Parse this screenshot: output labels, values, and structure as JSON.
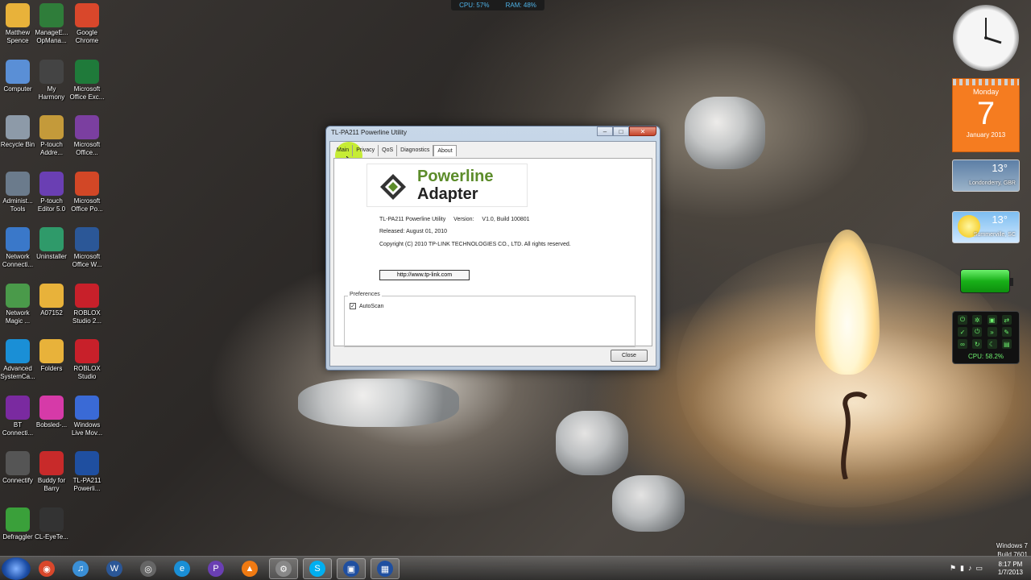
{
  "top_meter": {
    "cpu": "CPU: 57%",
    "ram": "RAM: 48%"
  },
  "desktop_icons": [
    {
      "label": "Matthew\nSpence",
      "icon": "folder-icon",
      "color": "#e8b23a"
    },
    {
      "label": "ManageE...\nOpMana...",
      "icon": "manage-engine-icon",
      "color": "#2f7d3a"
    },
    {
      "label": "Google\nChrome",
      "icon": "chrome-icon",
      "color": "#d9472b"
    },
    {
      "label": "Computer",
      "icon": "computer-icon",
      "color": "#5a8fd6"
    },
    {
      "label": "My\nHarmony",
      "icon": "harmony-icon",
      "color": "#444444"
    },
    {
      "label": "Microsoft\nOffice Exc...",
      "icon": "excel-icon",
      "color": "#1f7a3a"
    },
    {
      "label": "Recycle Bin",
      "icon": "recycle-bin-icon",
      "color": "#8d9aa8"
    },
    {
      "label": "P-touch\nAddre...",
      "icon": "ptouch-address-icon",
      "color": "#c49a3a"
    },
    {
      "label": "Microsoft\nOffice...",
      "icon": "onenote-icon",
      "color": "#7b3fa0"
    },
    {
      "label": "Administ...\nTools",
      "icon": "admin-tools-icon",
      "color": "#6b7b8c"
    },
    {
      "label": "P-touch\nEditor 5.0",
      "icon": "ptouch-editor-icon",
      "color": "#6a3fb3"
    },
    {
      "label": "Microsoft\nOffice Po...",
      "icon": "powerpoint-icon",
      "color": "#d24726"
    },
    {
      "label": "Network\nConnecti...",
      "icon": "network-connections-icon",
      "color": "#3a78c9"
    },
    {
      "label": "Uninstaller",
      "icon": "uninstaller-icon",
      "color": "#2f9a6a"
    },
    {
      "label": "Microsoft\nOffice W...",
      "icon": "word-icon",
      "color": "#2b5797"
    },
    {
      "label": "Network\nMagic ...",
      "icon": "network-magic-icon",
      "color": "#4a9a4a"
    },
    {
      "label": "A07152",
      "icon": "folder-icon",
      "color": "#e8b23a"
    },
    {
      "label": "ROBLOX\nStudio 2...",
      "icon": "roblox-icon",
      "color": "#c8202a"
    },
    {
      "label": "Advanced\nSystemCa...",
      "icon": "advanced-systemcare-icon",
      "color": "#1a8fd6"
    },
    {
      "label": "Folders",
      "icon": "folder-icon",
      "color": "#e8b23a"
    },
    {
      "label": "ROBLOX\nStudio",
      "icon": "roblox-icon",
      "color": "#c8202a"
    },
    {
      "label": "BT\nConnecti...",
      "icon": "bluetooth-icon",
      "color": "#7a2aa0"
    },
    {
      "label": "Bobsled-...",
      "icon": "bobsled-icon",
      "color": "#d63aa8"
    },
    {
      "label": "Windows\nLive Mov...",
      "icon": "movie-maker-icon",
      "color": "#3a6ad6"
    },
    {
      "label": "Connectify",
      "icon": "connectify-icon",
      "color": "#555555"
    },
    {
      "label": "Buddy for\nBarry",
      "icon": "buddy-icon",
      "color": "#c82a2a"
    },
    {
      "label": "TL-PA211\nPowerli...",
      "icon": "tplink-app-icon",
      "color": "#1f4fa0"
    },
    {
      "label": "Defraggler",
      "icon": "defraggler-icon",
      "color": "#3aa03a"
    },
    {
      "label": "CL-EyeTe...",
      "icon": "webcam-icon",
      "color": "#333333"
    }
  ],
  "gadgets": {
    "calendar": {
      "weekday": "Monday",
      "day": "7",
      "month_year": "January 2013"
    },
    "weather": [
      {
        "temp": "13°",
        "location": "Londonderry, GBR"
      },
      {
        "temp": "13°",
        "location": "Summerville, SC"
      }
    ],
    "controls": {
      "cpu": "CPU: 58.2%"
    }
  },
  "window": {
    "title": "TL-PA211 Powerline Utility",
    "tabs": [
      "Main",
      "Privacy",
      "QoS",
      "Diagnostics",
      "About"
    ],
    "active_tab": "About",
    "logo_line1": "Powerline",
    "logo_line2": "Adapter",
    "product": "TL-PA211 Powerline Utility",
    "version_label": "Version:",
    "version_value": "V1.0, Build 100801",
    "released": "Released: August 01, 2010",
    "copyright": "Copyright (C) 2010 TP-LINK TECHNOLOGIES CO., LTD. All rights reserved.",
    "link": "http://www.tp-link.com",
    "prefs_label": "Preferences",
    "autoscan_label": "AutoScan",
    "autoscan_checked": true,
    "close_label": "Close"
  },
  "taskbar": {
    "items": [
      "chrome-icon",
      "itunes-icon",
      "word-icon",
      "media-icon",
      "ie-icon",
      "ptouch-icon",
      "vlc-icon",
      "settings-icon",
      "skype-icon",
      "tplink-app-icon",
      "tplink-app-icon-2"
    ],
    "time": "8:17 PM",
    "date": "1/7/2013"
  },
  "watermark": {
    "line1": "Windows 7",
    "line2": "Build 7601"
  }
}
